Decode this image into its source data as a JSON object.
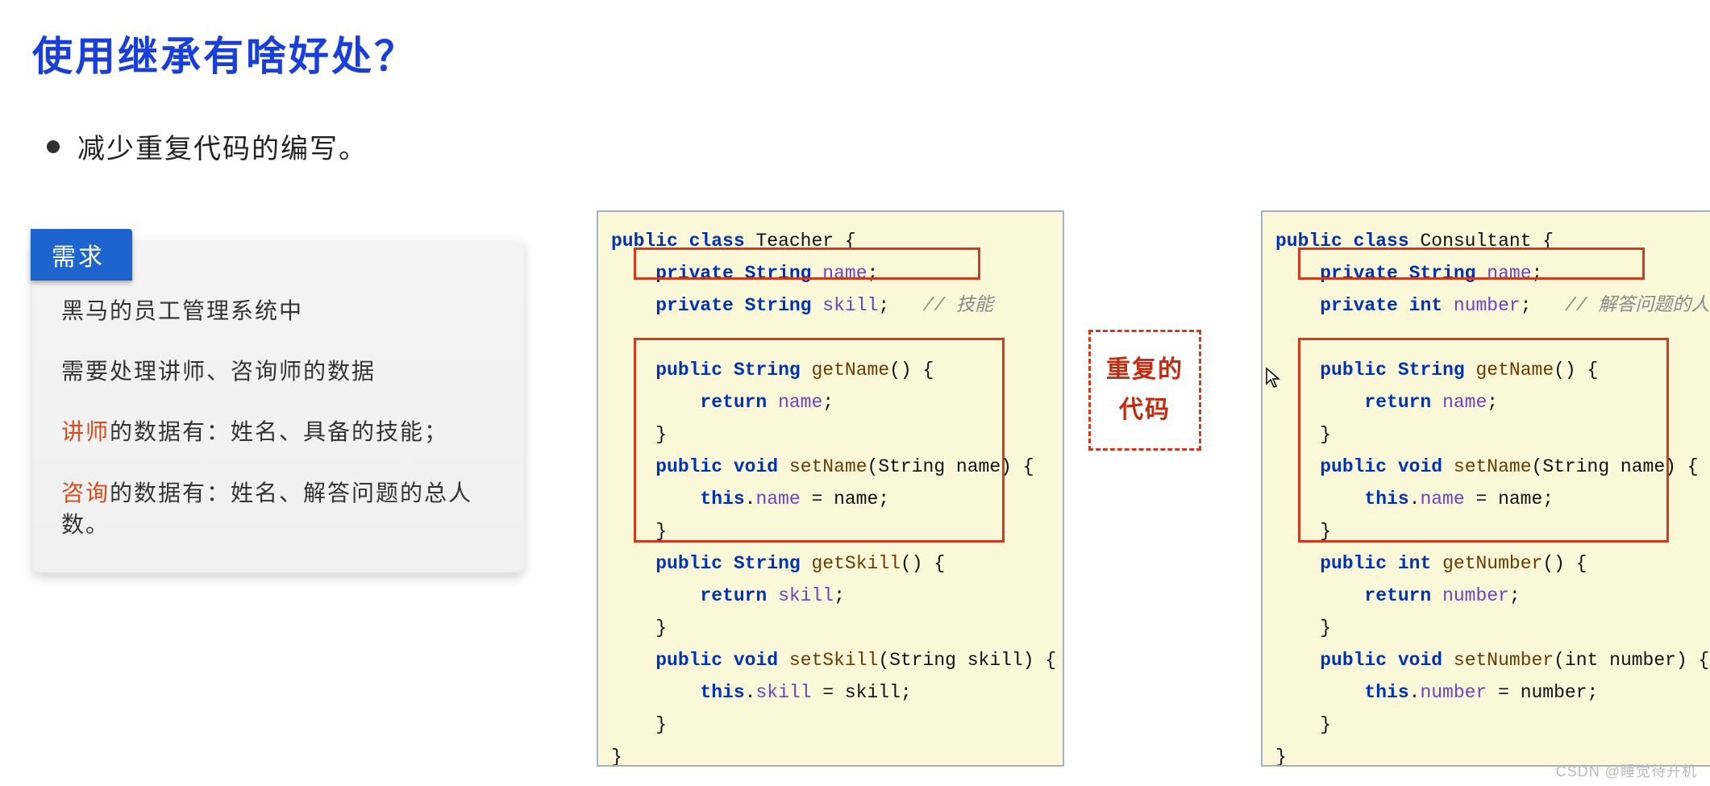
{
  "title": "使用继承有啥好处？",
  "bullet": "减少重复代码的编写。",
  "requirements": {
    "ribbon": "需求",
    "lines": {
      "l1": "黑马的员工管理系统中",
      "l2": "需要处理讲师、咨询师的数据",
      "l3_pre": "讲师",
      "l3_post": "的数据有：姓名、具备的技能；",
      "l4_pre": "咨询",
      "l4_post": "的数据有：姓名、解答问题的总人数。"
    }
  },
  "between_box": {
    "line1": "重复的",
    "line2": "代码"
  },
  "code_teacher": {
    "l1_kw1": "public",
    "l1_kw2": "class",
    "l1_name": "Teacher {",
    "l2_kw": "private",
    "l2_type": "String",
    "l2_fld": "name",
    "l2_end": ";",
    "l3_kw": "private",
    "l3_type": "String",
    "l3_fld": "skill",
    "l3_end": ";",
    "l3_cmt": "// 技能",
    "l5_kw": "public",
    "l5_type": "String",
    "l5_mth": "getName",
    "l5_rest": "() {",
    "l6_kw": "return",
    "l6_fld": "name",
    "l6_end": ";",
    "l7": "}",
    "l8_kw": "public",
    "l8_void": "void",
    "l8_mth": "setName",
    "l8_rest": "(String name) {",
    "l9_kw": "this",
    "l9_dot": ".",
    "l9_fld": "name",
    "l9_eq": " = name;",
    "l10": "}",
    "l11_kw": "public",
    "l11_type": "String",
    "l11_mth": "getSkill",
    "l11_rest": "() {",
    "l12_kw": "return",
    "l12_fld": "skill",
    "l12_end": ";",
    "l13": "}",
    "l14_kw": "public",
    "l14_void": "void",
    "l14_mth": "setSkill",
    "l14_rest": "(String skill) {",
    "l15_kw": "this",
    "l15_dot": ".",
    "l15_fld": "skill",
    "l15_eq": " = skill;",
    "l16": "}",
    "l17": "}"
  },
  "code_consultant": {
    "l1_kw1": "public",
    "l1_kw2": "class",
    "l1_name": "Consultant {",
    "l2_kw": "private",
    "l2_type": "String",
    "l2_fld": "name",
    "l2_end": ";",
    "l3_kw": "private",
    "l3_type": "int",
    "l3_fld": "number",
    "l3_end": ";",
    "l3_cmt": "// 解答问题的人数",
    "l5_kw": "public",
    "l5_type": "String",
    "l5_mth": "getName",
    "l5_rest": "() {",
    "l6_kw": "return",
    "l6_fld": "name",
    "l6_end": ";",
    "l7": "}",
    "l8_kw": "public",
    "l8_void": "void",
    "l8_mth": "setName",
    "l8_rest": "(String name) {",
    "l9_kw": "this",
    "l9_dot": ".",
    "l9_fld": "name",
    "l9_eq": " = name;",
    "l10": "}",
    "l11_kw": "public",
    "l11_type": "int",
    "l11_mth": "getNumber",
    "l11_rest": "() {",
    "l12_kw": "return",
    "l12_fld": "number",
    "l12_end": ";",
    "l13": "}",
    "l14_kw": "public",
    "l14_void": "void",
    "l14_mth": "setNumber",
    "l14_rest": "(int number) {",
    "l15_kw": "this",
    "l15_dot": ".",
    "l15_fld": "number",
    "l15_eq": " = number;",
    "l16": "}",
    "l17": "}"
  },
  "watermark": "CSDN @睡觉待开机"
}
